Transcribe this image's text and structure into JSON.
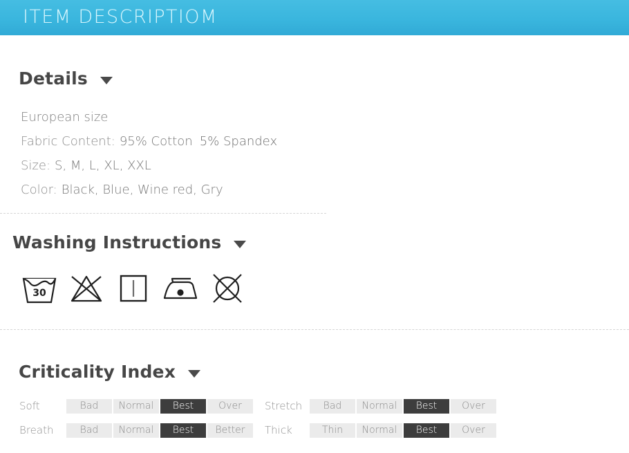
{
  "banner": {
    "title": "ITEM DESCRIPTIOM",
    "bg_color": "#3ab6de",
    "text_color": "#d9f6fd"
  },
  "details": {
    "heading": "Details",
    "caret": "chevron-down-icon",
    "european_size": "European size",
    "fabric_label": "Fabric Content:",
    "fabric_value_1": "95% Cotton",
    "fabric_value_2": "5% Spandex",
    "size_label": "Size:",
    "size_value": "S, M, L, XL, XXL",
    "color_label": "Color:",
    "color_value": "Black, Blue, Wine red, Gry"
  },
  "washing": {
    "heading": "Washing Instructions",
    "caret": "chevron-down-icon",
    "icons": [
      {
        "name": "wash-tub-30-icon",
        "label": "30",
        "meaning": "Machine wash at 30C"
      },
      {
        "name": "do-not-bleach-icon",
        "label": "",
        "meaning": "Do not bleach"
      },
      {
        "name": "line-dry-icon",
        "label": "",
        "meaning": "Line dry"
      },
      {
        "name": "iron-low-heat-icon",
        "label": "",
        "meaning": "Iron low heat"
      },
      {
        "name": "do-not-dry-clean-icon",
        "label": "",
        "meaning": "Do not dry clean"
      }
    ]
  },
  "criticality": {
    "heading": "Criticality Index",
    "caret": "chevron-down-icon",
    "active_color": "#3d3d3d",
    "inactive_color": "#ebebeb",
    "rows": [
      {
        "left": {
          "label": "Soft",
          "cells": [
            {
              "label": "Bad",
              "active": false
            },
            {
              "label": "Normal",
              "active": false
            },
            {
              "label": "Best",
              "active": true
            },
            {
              "label": "Over",
              "active": false
            }
          ]
        },
        "right": {
          "label": "Stretch",
          "cells": [
            {
              "label": "Bad",
              "active": false
            },
            {
              "label": "Normal",
              "active": false
            },
            {
              "label": "Best",
              "active": true
            },
            {
              "label": "Over",
              "active": false
            }
          ]
        }
      },
      {
        "left": {
          "label": "Breath",
          "cells": [
            {
              "label": "Bad",
              "active": false
            },
            {
              "label": "Normal",
              "active": false
            },
            {
              "label": "Best",
              "active": true
            },
            {
              "label": "Better",
              "active": false
            }
          ]
        },
        "right": {
          "label": "Thick",
          "cells": [
            {
              "label": "Thin",
              "active": false
            },
            {
              "label": "Normal",
              "active": false
            },
            {
              "label": "Best",
              "active": true
            },
            {
              "label": "Over",
              "active": false
            }
          ]
        }
      }
    ]
  }
}
